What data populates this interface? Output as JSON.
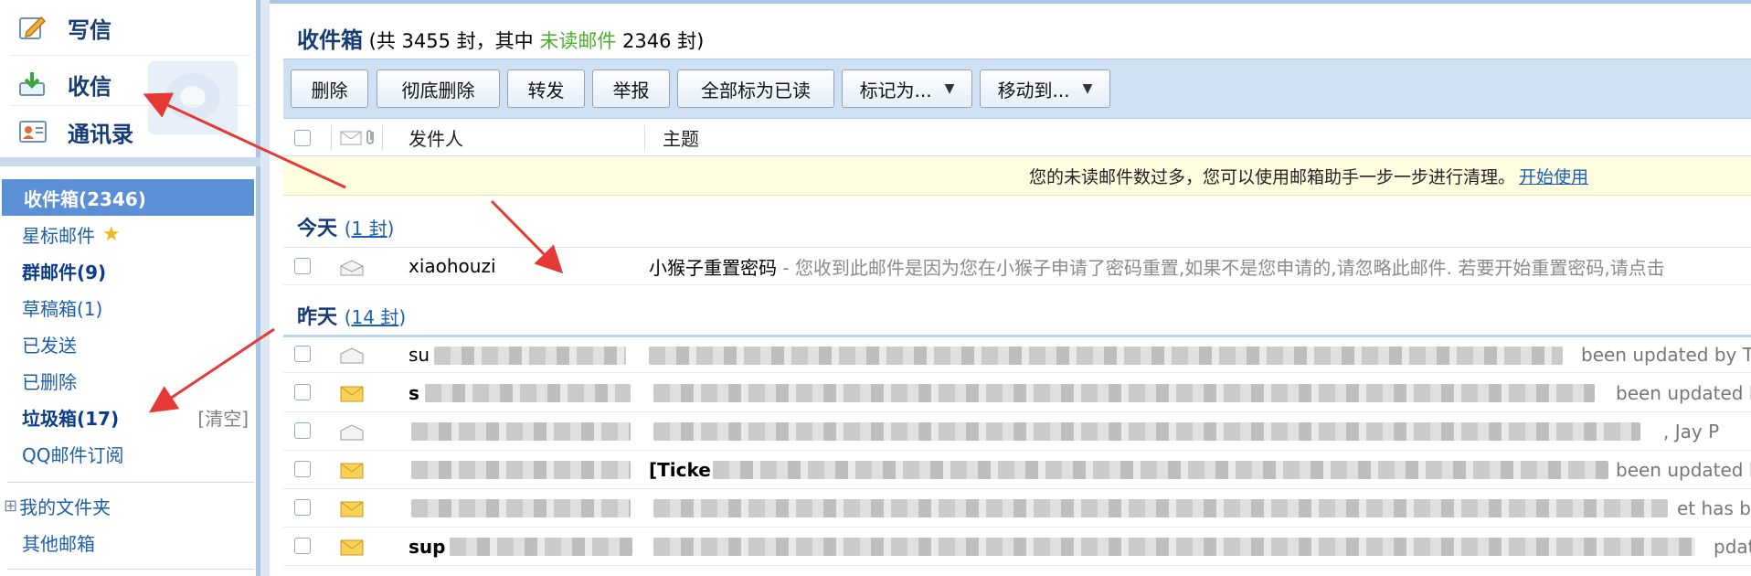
{
  "quick": {
    "compose": "写信",
    "receive": "收信",
    "contacts": "通讯录"
  },
  "folders": {
    "inbox": "收件箱(2346)",
    "starred": "星标邮件",
    "group": "群邮件(9)",
    "drafts": "草稿箱(1)",
    "sent": "已发送",
    "deleted": "已删除",
    "spam": "垃圾箱(17)",
    "spam_clear": "[清空]",
    "qq_subscribe": "QQ邮件订阅",
    "my_folders": "我的文件夹",
    "other_mail": "其他邮箱",
    "expand_symbol": "⊞"
  },
  "header": {
    "title": "收件箱",
    "summary_open": " (共 3455 封，其中 ",
    "unread_label": "未读邮件",
    "summary_close": " 2346 封)"
  },
  "toolbar": {
    "delete": "删除",
    "delete_forever": "彻底删除",
    "forward": "转发",
    "report": "举报",
    "mark_all_read": "全部标为已读",
    "mark_as": "标记为...",
    "move_to": "移动到...",
    "caret": "▼"
  },
  "table": {
    "col_sender": "发件人",
    "col_subject": "主题"
  },
  "notice": {
    "text": "您的未读邮件数过多，您可以使用邮箱助手一步一步进行清理。",
    "link": "开始使用"
  },
  "groups": {
    "today": "今天",
    "today_count_open": "(",
    "today_count": "1 封",
    "today_count_close": ")",
    "yesterday": "昨天",
    "yesterday_count_open": "(",
    "yesterday_count": "14 封",
    "yesterday_count_close": ")"
  },
  "today_mail": {
    "sender": "xiaohouzi",
    "subject": "小猴子重置密码",
    "separator": " - ",
    "preview": "您收到此邮件是因为您在小猴子申请了密码重置,如果不是您申请的,请忽略此邮件. 若要开始重置密码,请点击"
  },
  "yesterday_mail": [
    {
      "sender": "su",
      "tail": "been updated by Ta",
      "unread": false
    },
    {
      "sender": "s",
      "tail": "been updated b",
      "unread": true
    },
    {
      "sender": "",
      "tail": ", Jay P",
      "unread": false
    },
    {
      "sender": "",
      "subject": "[Ticke",
      "tail": "been updated b",
      "unread": true
    },
    {
      "sender": "",
      "tail": "et has be",
      "unread": true
    },
    {
      "sender": "sup",
      "tail": "pdat",
      "unread": true
    }
  ],
  "colors": {
    "accent": "#163c78",
    "active_folder": "#5b8fd6",
    "unread_green": "#4caf2a",
    "annotation_red": "#e53935"
  }
}
